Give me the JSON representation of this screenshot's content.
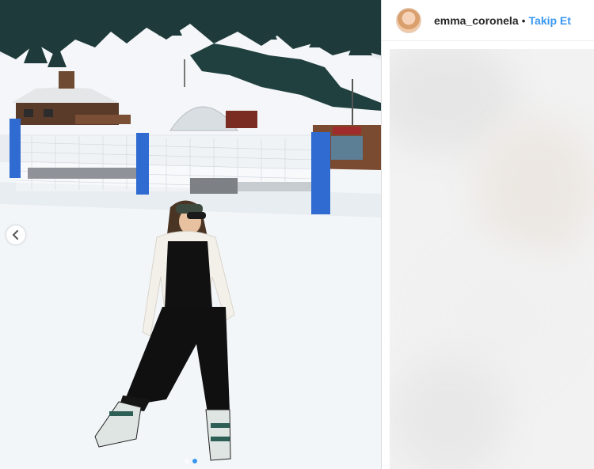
{
  "post": {
    "image_description_icon": "ski-slope-photo",
    "carousel": {
      "active_index": 1,
      "count": 2
    },
    "prev_icon": "chevron-left-icon"
  },
  "sidebar": {
    "username": "emma_coronela",
    "separator": "•",
    "follow_label": "Takip Et",
    "avatar_icon": "profile-avatar"
  },
  "colors": {
    "follow": "#3897f0",
    "username": "#262626",
    "fence_post": "#2f6bd0"
  }
}
